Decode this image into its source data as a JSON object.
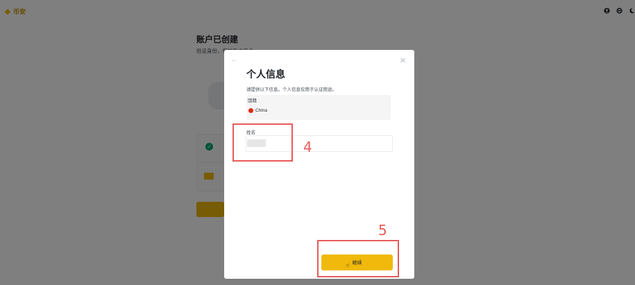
{
  "header": {
    "logo_text": "币安"
  },
  "background": {
    "title": "账户已创建",
    "subtitle": "验证身份，",
    "subtitle_partial": "保护账户安全"
  },
  "modal": {
    "title": "个人信息",
    "description": "请提供以下信息。个人信息仅用于认证用途。",
    "nationality_label": "国籍",
    "nationality_value": "China",
    "name_label": "姓名",
    "continue_label": "继续"
  },
  "annotations": {
    "step4": "4",
    "step5": "5"
  },
  "colors": {
    "accent": "#f0b90b",
    "annotation": "#e85a5a",
    "overlay": "rgba(0,0,0,0.5)"
  }
}
